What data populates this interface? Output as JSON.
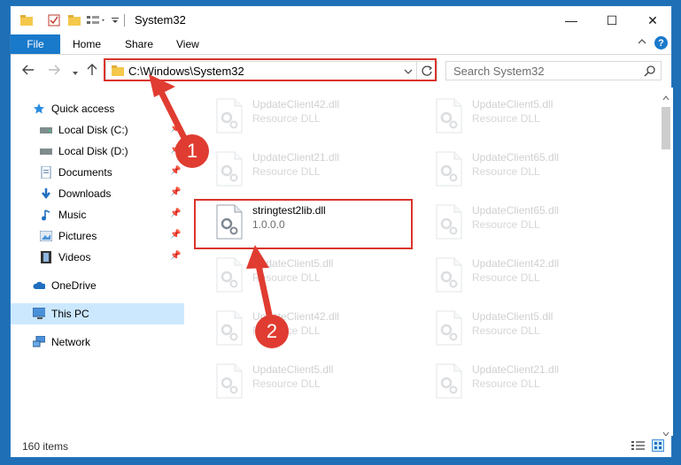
{
  "window": {
    "title": "System32",
    "minimize_glyph": "—",
    "maximize_glyph": "☐",
    "close_glyph": "✕"
  },
  "ribbon": {
    "file": "File",
    "home": "Home",
    "share": "Share",
    "view": "View",
    "help_glyph": "?"
  },
  "address": {
    "path": "C:\\Windows\\System32",
    "search_placeholder": "Search System32"
  },
  "nav": {
    "items": [
      {
        "label": "Quick access",
        "icon": "star-icon"
      },
      {
        "label": "Local Disk (C:)",
        "icon": "drive-icon"
      },
      {
        "label": "Local Disk (D:)",
        "icon": "drive-icon"
      },
      {
        "label": "Documents",
        "icon": "documents-icon"
      },
      {
        "label": "Downloads",
        "icon": "download-icon"
      },
      {
        "label": "Music",
        "icon": "music-icon"
      },
      {
        "label": "Pictures",
        "icon": "pictures-icon"
      },
      {
        "label": "Videos",
        "icon": "videos-icon"
      },
      {
        "label": "OneDrive",
        "icon": "cloud-icon"
      },
      {
        "label": "This PC",
        "icon": "computer-icon"
      },
      {
        "label": "Network",
        "icon": "network-icon"
      }
    ]
  },
  "files": [
    {
      "name": "UpdateClient42.dll",
      "desc": "Resource DLL"
    },
    {
      "name": "UpdateClient5.dll",
      "desc": "Resource DLL"
    },
    {
      "name": "UpdateClient21.dll",
      "desc": "Resource DLL"
    },
    {
      "name": "UpdateClient65.dll",
      "desc": "Resource DLL"
    },
    {
      "name": "stringtest2lib.dll",
      "desc": "1.0.0.0"
    },
    {
      "name": "UpdateClient65.dll",
      "desc": "Resource DLL"
    },
    {
      "name": "UpdateClient5.dll",
      "desc": "Resource DLL"
    },
    {
      "name": "UpdateClient42.dll",
      "desc": "Resource DLL"
    },
    {
      "name": "UpdateClient42.dll",
      "desc": "Resource DLL"
    },
    {
      "name": "UpdateClient5.dll",
      "desc": "Resource DLL"
    },
    {
      "name": "UpdateClient5.dll",
      "desc": "Resource DLL"
    },
    {
      "name": "UpdateClient21.dll",
      "desc": "Resource DLL"
    }
  ],
  "status": {
    "count": "160 items"
  },
  "annotations": {
    "step1": "1",
    "step2": "2"
  },
  "colors": {
    "accent": "#1979ca",
    "highlight": "#d9342b",
    "selection": "#cce8ff"
  }
}
